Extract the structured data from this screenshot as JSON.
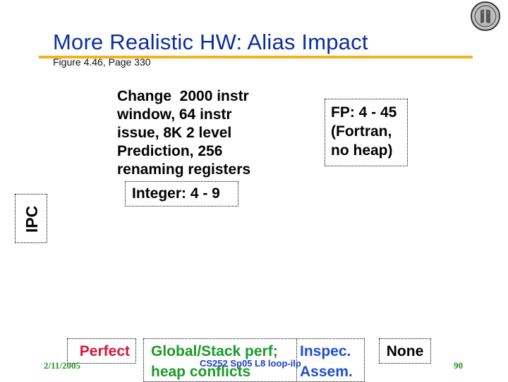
{
  "slide": {
    "title": "More Realistic HW: Alias Impact",
    "subtitle": "Figure 4.46, Page 330",
    "accent_color": "#f0b41e",
    "title_color": "#0b2e9c"
  },
  "body": {
    "description": "Change  2000 instr\nwindow, 64 instr\nissue, 8K 2 level\nPrediction, 256\nrenaming registers",
    "integer_label": "Integer: 4 - 9",
    "fp_label": "FP: 4 - 45\n(Fortran,\nno heap)",
    "axis_label": "IPC"
  },
  "categories": [
    {
      "label": "Perfect",
      "color": "#d6163c"
    },
    {
      "label": "Global/Stack perf;\nheap conflicts",
      "color": "#1a9a28"
    },
    {
      "label": "Inspec.\nAssem.",
      "color": "#1f4fd1"
    },
    {
      "label": "None",
      "color": "#000000"
    }
  ],
  "footer": {
    "date": "2/11/2005",
    "course": "CS252 Sp05 L8 loop-ilp",
    "page": "90"
  },
  "logo": {
    "icon": "university-seal-icon"
  }
}
